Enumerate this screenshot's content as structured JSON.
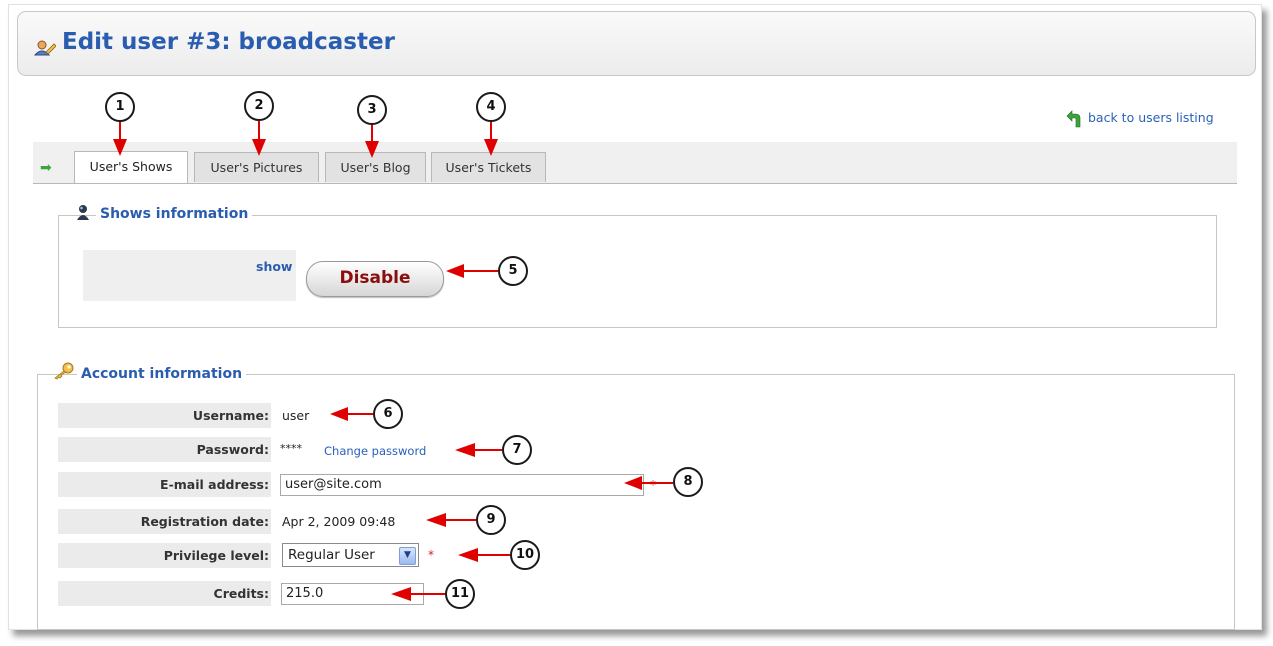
{
  "header": {
    "title": "Edit user #3: broadcaster",
    "icon": "user-edit-icon"
  },
  "back_link": {
    "label": "back to users listing",
    "icon": "curved-back-arrow-icon"
  },
  "tabs": [
    {
      "label": "User's Shows",
      "active": true
    },
    {
      "label": "User's Pictures",
      "active": false
    },
    {
      "label": "User's Blog",
      "active": false
    },
    {
      "label": "User's Tickets",
      "active": false
    }
  ],
  "shows_section": {
    "title": "Shows information",
    "icon": "broadcaster-icon",
    "show_label": "show",
    "disable_button": "Disable"
  },
  "account_section": {
    "title": "Account information",
    "icon": "key-icon",
    "username": {
      "label": "Username:",
      "value": "user"
    },
    "password": {
      "label": "Password:",
      "value": "****",
      "link": "Change password"
    },
    "email": {
      "label": "E-mail address:",
      "value": "user@site.com",
      "required": "*"
    },
    "registration": {
      "label": "Registration date:",
      "value": "Apr 2, 2009 09:48"
    },
    "privilege": {
      "label": "Privilege level:",
      "value": "Regular User",
      "required": "*"
    },
    "credits": {
      "label": "Credits:",
      "value": "215.0"
    }
  },
  "callouts": [
    "1",
    "2",
    "3",
    "4",
    "5",
    "6",
    "7",
    "8",
    "9",
    "10",
    "11"
  ],
  "colors": {
    "title_blue": "#2a5db0",
    "annotation_arrow": "#e00000",
    "disable_text": "#8b0d0d"
  }
}
